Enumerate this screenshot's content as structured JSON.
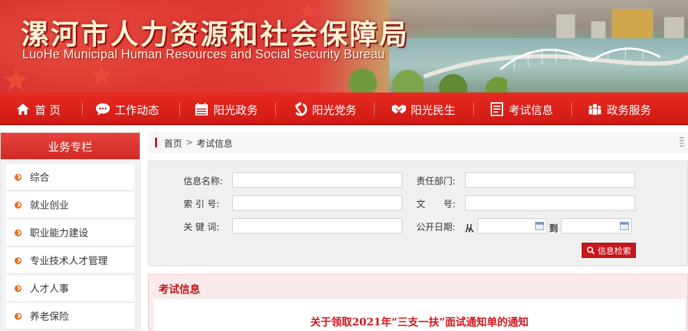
{
  "header": {
    "title_cn": "漯河市人力资源和社会保障局",
    "title_en": "LuoHe Municipal Human Resources and Social Security Bureau"
  },
  "nav": [
    {
      "label": "首 页",
      "icon": "home-icon"
    },
    {
      "label": "工作动态",
      "icon": "chat-bubble-icon"
    },
    {
      "label": "阳光政务",
      "icon": "calendar-icon"
    },
    {
      "label": "阳光党务",
      "icon": "hammer-sickle-icon"
    },
    {
      "label": "阳光民生",
      "icon": "handshake-icon"
    },
    {
      "label": "考试信息",
      "icon": "document-list-icon"
    },
    {
      "label": "政务服务",
      "icon": "people-group-icon"
    }
  ],
  "sidebar": {
    "title": "业务专栏",
    "items": [
      {
        "label": "综合"
      },
      {
        "label": "就业创业"
      },
      {
        "label": "职业能力建设"
      },
      {
        "label": "专业技术人才管理"
      },
      {
        "label": "人才人事"
      },
      {
        "label": "养老保险"
      }
    ]
  },
  "breadcrumb": {
    "home": "首页",
    "separator": ">",
    "current": "考试信息"
  },
  "search": {
    "info_name_label": "信息名称:",
    "department_label": "责任部门:",
    "index_label": "索 引 号:",
    "doc_no_label": "文　　号:",
    "keyword_label": "关 键 词:",
    "date_label": "公开日期:",
    "from_label": "从",
    "to_label": "到",
    "info_name_value": "",
    "department_value": "",
    "index_value": "",
    "doc_no_value": "",
    "keyword_value": "",
    "date_from_value": "",
    "date_to_value": "",
    "button_label": "信息检索"
  },
  "content": {
    "section_title": "考试信息",
    "article_title": "关于领取2021年“三支一扶”面试通知单的通知"
  },
  "colors": {
    "primary_red": "#d12b27",
    "nav_red": "#cf1a14",
    "accent_orange": "#ea6a1a",
    "panel_pink": "#fbeaea"
  }
}
